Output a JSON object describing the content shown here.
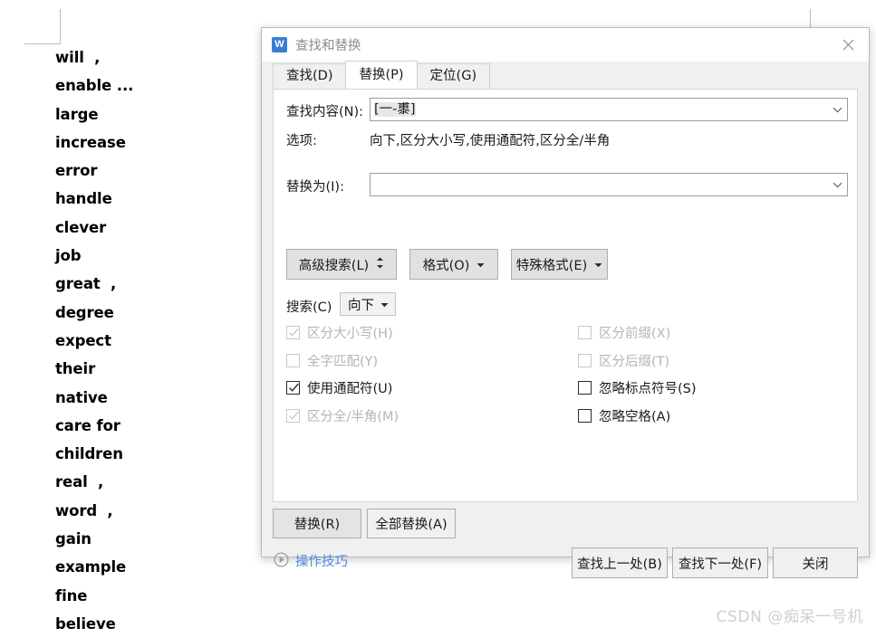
{
  "document": {
    "words": [
      "will  ,",
      "enable ...",
      "large",
      "increase",
      "error",
      "handle",
      "clever",
      "job",
      "great  ,",
      "degree",
      "expect",
      "their",
      "native",
      "care for",
      "children",
      "real  ,",
      "word  ,",
      "gain",
      "example",
      "fine",
      "believe"
    ],
    "watermark": "CSDN @痴呆一号机"
  },
  "dialog": {
    "title": "查找和替换",
    "app_icon": "wps-writer-icon",
    "close_icon": "close-icon",
    "tabs": [
      {
        "label": "查找(D)",
        "active": false
      },
      {
        "label": "替换(P)",
        "active": true
      },
      {
        "label": "定位(G)",
        "active": false
      }
    ],
    "find": {
      "label": "查找内容(N):",
      "value": "[一-鿿]",
      "placeholder": "",
      "dropdown_icon": "chevron-down-icon"
    },
    "options": {
      "label": "选项:",
      "value": "向下,区分大小写,使用通配符,区分全/半角"
    },
    "replace": {
      "label": "替换为(I):",
      "value": "",
      "placeholder": "",
      "dropdown_icon": "chevron-down-icon"
    },
    "buttons": {
      "advanced_search": "高级搜索(L)",
      "advanced_search_icon": "updown-arrow-icon",
      "format": "格式(O)",
      "format_icon": "caret-down-icon",
      "special_format": "特殊格式(E)",
      "special_format_icon": "caret-down-icon"
    },
    "search_direction": {
      "label": "搜索(C)",
      "value": "向下",
      "icon": "caret-down-icon"
    },
    "checkboxes_left": [
      {
        "label": "区分大小写(H)",
        "checked": true,
        "disabled": true
      },
      {
        "label": "全字匹配(Y)",
        "checked": false,
        "disabled": true
      },
      {
        "label": "使用通配符(U)",
        "checked": true,
        "disabled": false
      },
      {
        "label": "区分全/半角(M)",
        "checked": true,
        "disabled": true
      }
    ],
    "checkboxes_right": [
      {
        "label": "区分前缀(X)",
        "checked": false,
        "disabled": true
      },
      {
        "label": "区分后缀(T)",
        "checked": false,
        "disabled": true
      },
      {
        "label": "忽略标点符号(S)",
        "checked": false,
        "disabled": false
      },
      {
        "label": "忽略空格(A)",
        "checked": false,
        "disabled": false
      }
    ],
    "footer": {
      "replace": "替换(R)",
      "replace_all": "全部替换(A)",
      "tips_label": "操作技巧",
      "tips_icon": "play-circle-icon",
      "find_prev": "查找上一处(B)",
      "find_next": "查找下一处(F)",
      "close": "关闭"
    }
  },
  "colors": {
    "accent": "#3a7dd8",
    "link": "#4b8bdc",
    "dialog_bg": "#f0f0f0",
    "panel_bg": "#ffffff",
    "disabled_text": "#b5b5b5"
  }
}
